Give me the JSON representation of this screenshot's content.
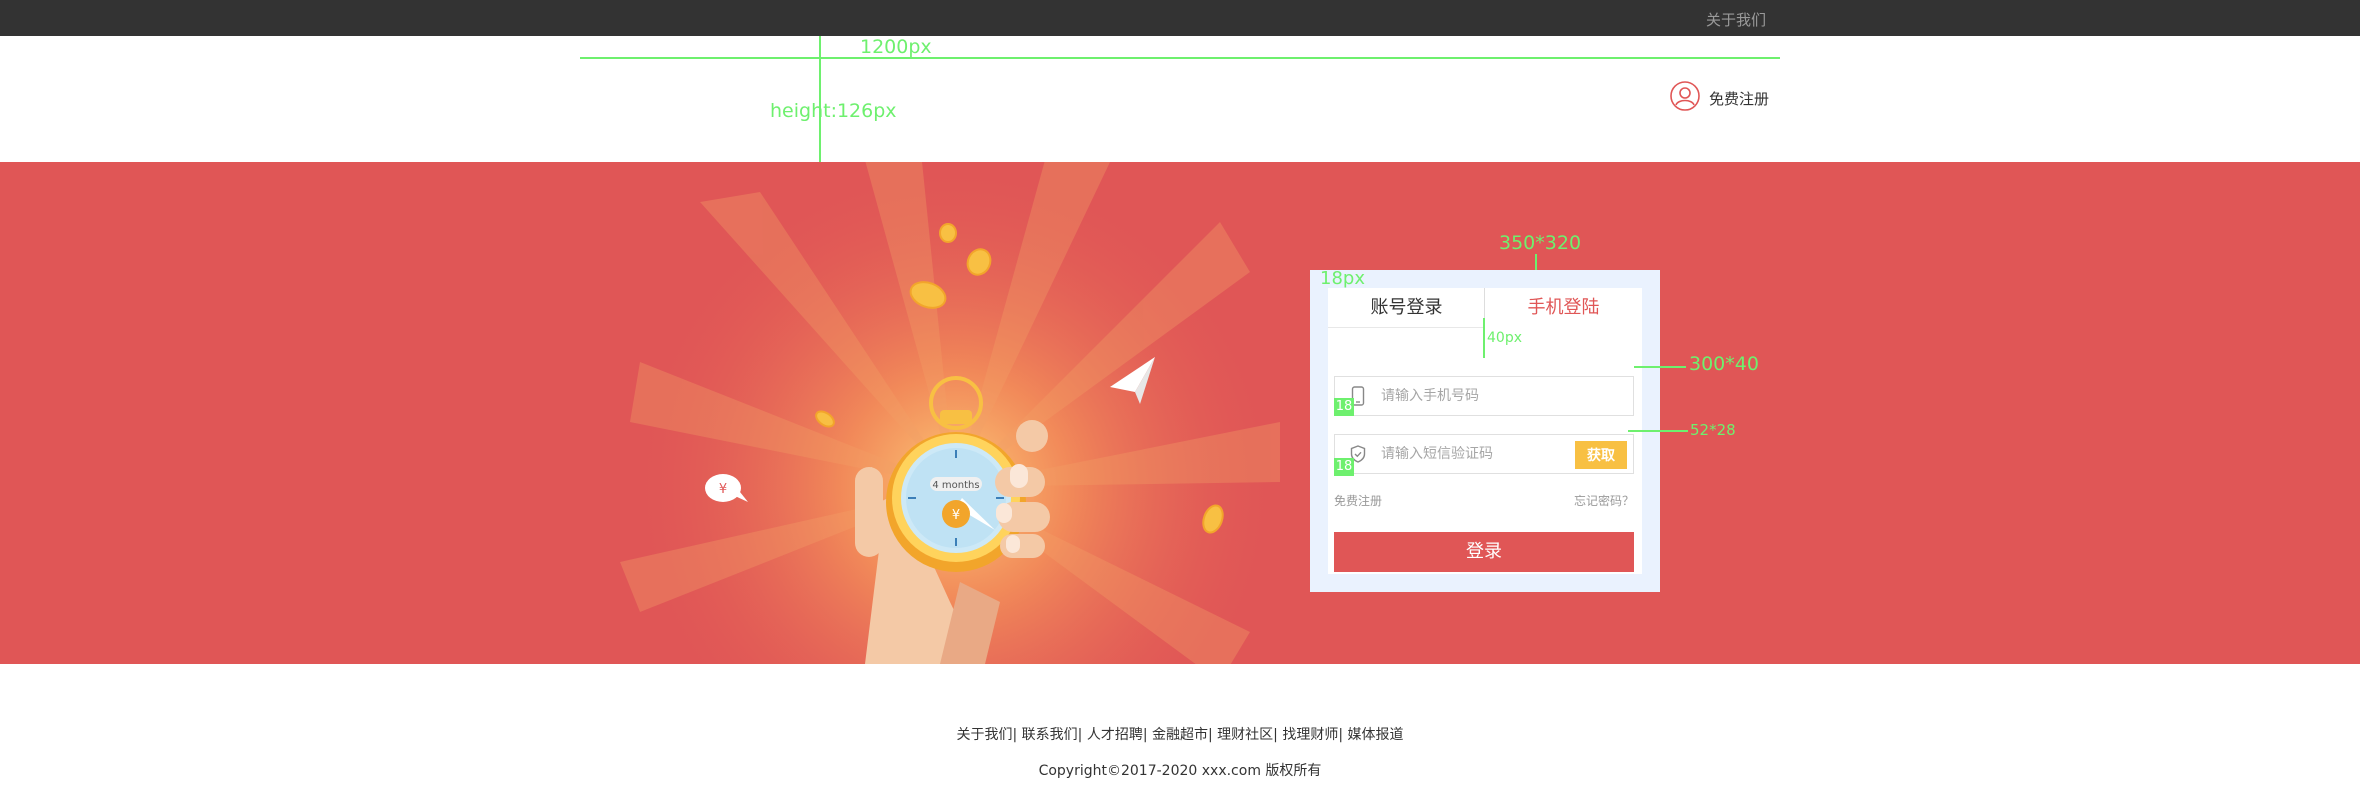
{
  "topbar": {
    "about_label": "关于我们"
  },
  "header": {
    "register_label": "免费注册"
  },
  "annotations": {
    "width_label": "1200px",
    "height_label": "height:126px",
    "card_size_label": "350*320",
    "card_padding_label": "18px",
    "tab_height_label": "40px",
    "input_size_label": "300*40",
    "gap_label_1": "18",
    "gap_label_2": "18",
    "button_size_label": "52*28"
  },
  "illustration": {
    "stopwatch_label": "4 months",
    "coin_symbol": "¥"
  },
  "login": {
    "tab_account": "账号登录",
    "tab_phone": "手机登陆",
    "phone_placeholder": "请输入手机号码",
    "code_placeholder": "请输入短信验证码",
    "get_code_label": "获取",
    "free_register": "免费注册",
    "forgot_password": "忘记密码？",
    "submit_label": "登录"
  },
  "footer": {
    "links": [
      "关于我们",
      "联系我们",
      "人才招聘",
      "金融超市",
      "理财社区",
      "找理财师",
      "媒体报道"
    ],
    "copyright": "Copyright©2017-2020  xxx.com 版权所有"
  },
  "colors": {
    "brand": "#e05656",
    "topbar": "#333333",
    "accent": "#f8c043",
    "annotation": "#6ef06e"
  }
}
